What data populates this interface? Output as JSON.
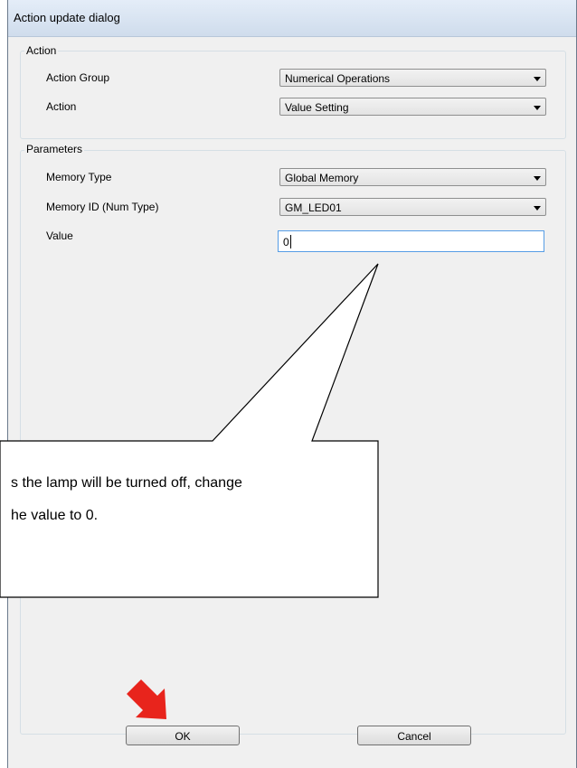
{
  "window": {
    "title": "Action update dialog"
  },
  "action_group": {
    "legend": "Action",
    "rows": [
      {
        "label": "Action Group",
        "value": "Numerical Operations"
      },
      {
        "label": "Action",
        "value": "Value Setting"
      }
    ]
  },
  "params_group": {
    "legend": "Parameters",
    "memory_type": {
      "label": "Memory Type",
      "value": "Global Memory"
    },
    "memory_id": {
      "label": "Memory ID (Num Type)",
      "value": "GM_LED01"
    },
    "value": {
      "label": "Value",
      "value": "0"
    }
  },
  "buttons": {
    "ok": "OK",
    "cancel": "Cancel"
  },
  "callout": {
    "line1": "s the lamp will be turned off, change",
    "line2": "he value to 0."
  },
  "colors": {
    "pointer_arrow": "#e8241c",
    "focus_border": "#569de5"
  },
  "icons": {
    "pointer": "red-arrow-icon",
    "dropdown": "chevron-down-icon"
  }
}
